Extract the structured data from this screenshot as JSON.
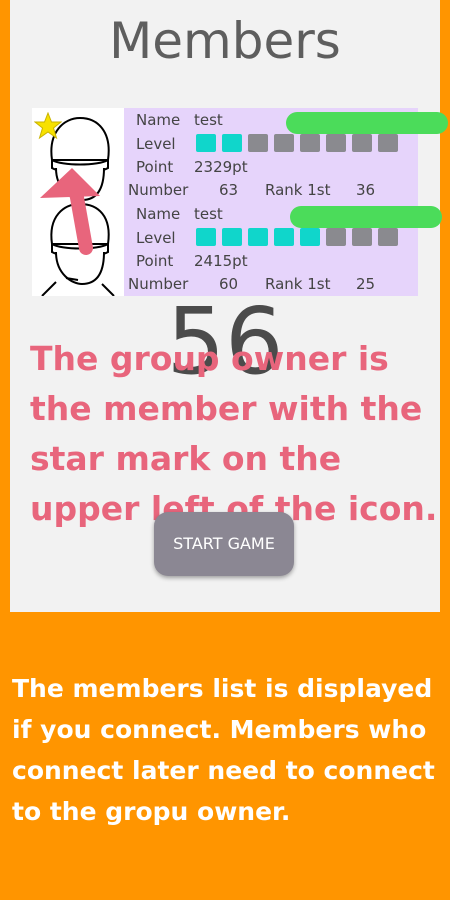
{
  "header": {
    "title": "Members"
  },
  "members": [
    {
      "name_label": "Name",
      "name": "test",
      "level_label": "Level",
      "level_filled": 2,
      "level_total": 8,
      "point_label": "Point",
      "point": "2329pt",
      "number_label": "Number",
      "number": "63",
      "rank_label": "Rank 1st",
      "rank_value": "36",
      "is_owner": true
    },
    {
      "name_label": "Name",
      "name": "test",
      "level_label": "Level",
      "level_filled": 5,
      "level_total": 8,
      "point_label": "Point",
      "point": "2415pt",
      "number_label": "Number",
      "number": "60",
      "rank_label": "Rank 1st",
      "rank_value": "25",
      "is_owner": false
    }
  ],
  "countdown": "56",
  "overlay_text": "The group owner is the member with the star mark on the upper left of the icon.",
  "start_button": "START GAME",
  "footer_text": "The members list is displayed if you connect. Members who connect later need to connect to the gropu owner.",
  "colors": {
    "background": "#ff9500",
    "card": "#f2f2f2",
    "info_panel": "#e6d4fb",
    "name_bar": "#4bdc5a",
    "level_on": "#10d6cb",
    "level_off": "#8a8a8f",
    "overlay_text": "#e8657c",
    "star": "#f7e100"
  }
}
